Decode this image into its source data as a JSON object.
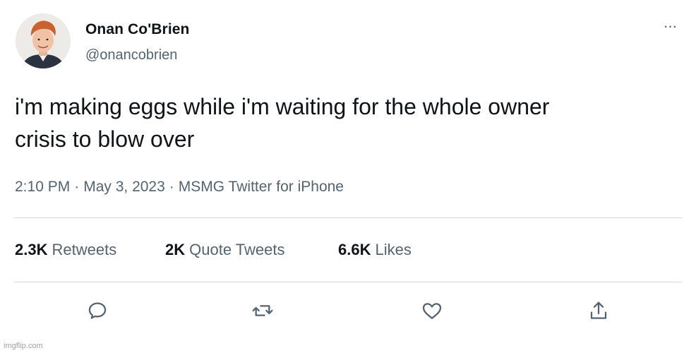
{
  "author": {
    "display_name": "Onan Co'Brien",
    "handle": "@onancobrien"
  },
  "tweet": {
    "text_line1": "i'm making eggs while i'm waiting for the whole owner",
    "text_line2": "crisis to blow over",
    "time": "2:10 PM",
    "date": "May 3, 2023",
    "source": "MSMG Twitter for iPhone",
    "separator": "·"
  },
  "stats": {
    "retweets_count": "2.3K",
    "retweets_label": "Retweets",
    "quotes_count": "2K",
    "quotes_label": "Quote Tweets",
    "likes_count": "6.6K",
    "likes_label": "Likes"
  },
  "more_glyph": "···",
  "actions": [
    "reply-icon",
    "retweet-icon",
    "like-icon",
    "share-icon"
  ],
  "watermark": "imgflip.com",
  "colors": {
    "primary_text": "#0f1419",
    "secondary_text": "#536471",
    "divider": "#cfd9de"
  }
}
